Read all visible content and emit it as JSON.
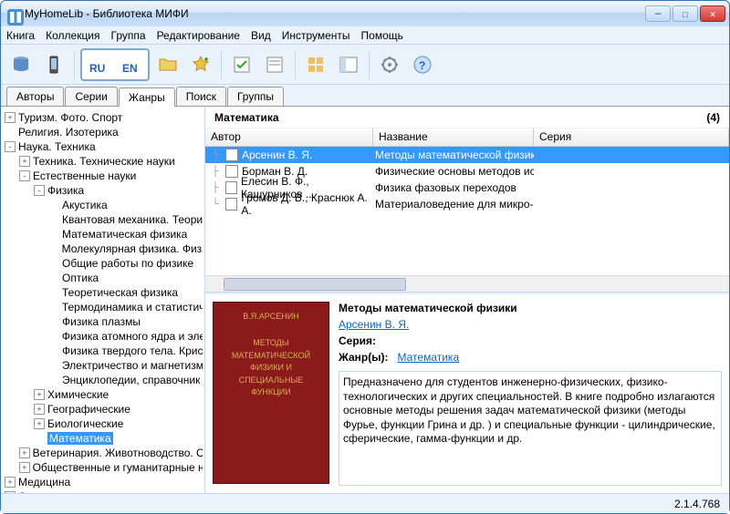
{
  "window_title": "MyHomeLib - Библиотека МИФИ",
  "menus": [
    "Книга",
    "Коллекция",
    "Группа",
    "Редактирование",
    "Вид",
    "Инструменты",
    "Помощь"
  ],
  "tabs": [
    "Авторы",
    "Серии",
    "Жанры",
    "Поиск",
    "Группы"
  ],
  "active_tab": 2,
  "tree": [
    {
      "d": 0,
      "e": "+",
      "t": "Туризм. Фото. Спорт"
    },
    {
      "d": 0,
      "e": "",
      "t": "Религия. Изотерика"
    },
    {
      "d": 0,
      "e": "-",
      "t": "Наука. Техника"
    },
    {
      "d": 1,
      "e": "+",
      "t": "Техника. Технические науки"
    },
    {
      "d": 1,
      "e": "-",
      "t": "Естественные науки"
    },
    {
      "d": 2,
      "e": "-",
      "t": "Физика"
    },
    {
      "d": 3,
      "e": "",
      "t": "Акустика"
    },
    {
      "d": 3,
      "e": "",
      "t": "Квантовая механика. Теори"
    },
    {
      "d": 3,
      "e": "",
      "t": "Математическая физика"
    },
    {
      "d": 3,
      "e": "",
      "t": "Молекулярная физика. Физи"
    },
    {
      "d": 3,
      "e": "",
      "t": "Общие работы по физике"
    },
    {
      "d": 3,
      "e": "",
      "t": "Оптика"
    },
    {
      "d": 3,
      "e": "",
      "t": "Теоретическая физика"
    },
    {
      "d": 3,
      "e": "",
      "t": "Термодинамика и статистич"
    },
    {
      "d": 3,
      "e": "",
      "t": "Физика плазмы"
    },
    {
      "d": 3,
      "e": "",
      "t": "Физика атомного ядра и эле"
    },
    {
      "d": 3,
      "e": "",
      "t": "Физика твердого тела. Крис"
    },
    {
      "d": 3,
      "e": "",
      "t": "Электричество и магнетизм"
    },
    {
      "d": 3,
      "e": "",
      "t": "Энциклопедии, справочник"
    },
    {
      "d": 2,
      "e": "+",
      "t": "Химические"
    },
    {
      "d": 2,
      "e": "+",
      "t": "Географические"
    },
    {
      "d": 2,
      "e": "+",
      "t": "Биологические"
    },
    {
      "d": 2,
      "e": "",
      "t": "Математика",
      "sel": true
    },
    {
      "d": 1,
      "e": "+",
      "t": "Ветеринария. Животноводство. Се"
    },
    {
      "d": 1,
      "e": "+",
      "t": "Общественные и гуманитарные на"
    },
    {
      "d": 0,
      "e": "+",
      "t": "Медицина"
    },
    {
      "d": 0,
      "e": "+",
      "t": "Справочная литература"
    }
  ],
  "category": {
    "name": "Математика",
    "count": "(4)"
  },
  "grid_headers": [
    "Автор",
    "Название",
    "Серия"
  ],
  "rows": [
    {
      "author": "Арсенин В. Я.",
      "title": "Методы математической физики",
      "sel": true
    },
    {
      "author": "Борман В. Д.",
      "title": "Физические основы методов иссл..."
    },
    {
      "author": "Елесин В. Ф., Кашурников ...",
      "title": "Физика фазовых переходов"
    },
    {
      "author": "Громов Д. В., Краснюк А. А.",
      "title": "Материаловедение для микро- и н..."
    }
  ],
  "detail": {
    "title": "Методы математической физики",
    "author": "Арсенин В. Я.",
    "series_label": "Серия:",
    "genre_label": "Жанр(ы):",
    "genre": "Математика",
    "desc": "Предназначено для студентов инженерно-физических, физико- технологических и других специальностей. В книге подробно излагаются основные методы решения задач математической физики (методы Фурье, функции Грина и др. ) и специальные функции - цилиндрические, сферические, гамма-функции и др.",
    "cover_author": "В.Я.АРСЕНИН",
    "cover_title": "МЕТОДЫ МАТЕМАТИЧЕСКОЙ ФИЗИКИ И СПЕЦИАЛЬНЫЕ ФУНКЦИИ"
  },
  "status": "2.1.4.768"
}
